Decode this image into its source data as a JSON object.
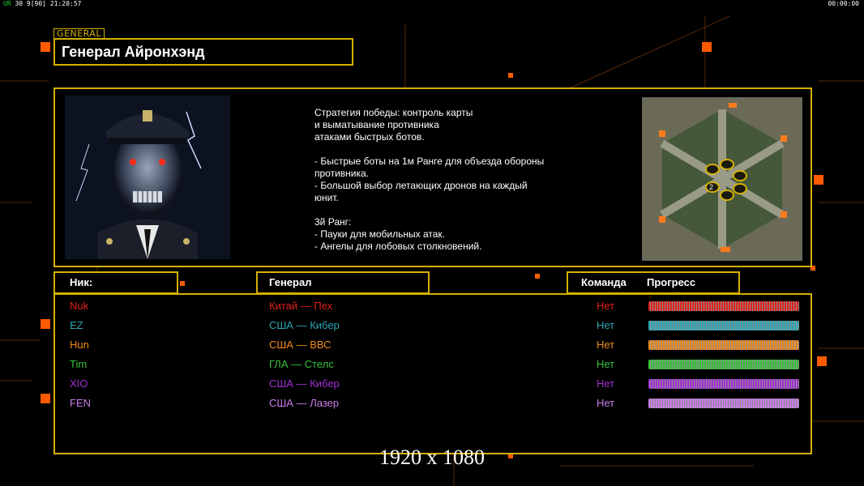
{
  "status_left": {
    "prefix": "UR",
    "value": "30 9[90]",
    "clock": "21:20:57"
  },
  "status_right": "00:00:00",
  "general_tag": "GENERAL",
  "general_name": "Генерал Айронхэнд",
  "description": "Стратегия победы: контроль карты\nи выматывание противника\nатаками быстрых ботов.\n\n- Быстрые боты на 1м Ранге для объезда обороны\n  противника.\n- Большой выбор летающих дронов на каждый\n  юнит.\n\n3й Ранг:\n- Пауки для мобильных атак.\n- Ангелы для лобовых столкновений.",
  "headers": {
    "nick": "Ник:",
    "general": "Генерал",
    "team": "Команда",
    "progress": "Прогресс"
  },
  "players": [
    {
      "nick": "Nuk",
      "general": "Китай — Пех",
      "team": "Нет",
      "color": "#e0201a"
    },
    {
      "nick": "EZ",
      "general": "США — Кибер",
      "team": "Нет",
      "color": "#2aa6b5"
    },
    {
      "nick": "Hun",
      "general": "США — ВВС",
      "team": "Нет",
      "color": "#f08a1c"
    },
    {
      "nick": "Tim",
      "general": "ГЛА — Стелс",
      "team": "Нет",
      "color": "#36c23a"
    },
    {
      "nick": "XIO",
      "general": "США — Кибер",
      "team": "Нет",
      "color": "#a32fd6"
    },
    {
      "nick": "FEN",
      "general": "США — Лазер",
      "team": "Нет",
      "color": "#c97be8"
    }
  ],
  "resolution_label": "1920 x 1080",
  "minimap_marker": "2",
  "colors": {
    "frame": "#d4b000",
    "accent_orange": "#ff6a00"
  }
}
